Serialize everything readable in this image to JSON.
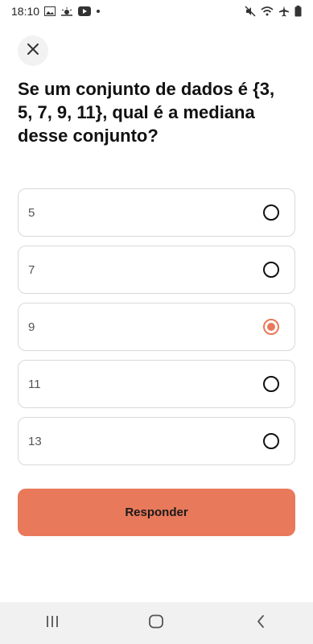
{
  "status_bar": {
    "time": "18:10",
    "left_icons": [
      "image-icon",
      "weather-icon",
      "youtube-icon",
      "dot-icon"
    ],
    "right_icons": [
      "mute-icon",
      "wifi-icon",
      "airplane-icon",
      "battery-icon"
    ]
  },
  "question": {
    "text": "Se um conjunto de dados é {3, 5, 7, 9, 11}, qual é a mediana desse conjunto?"
  },
  "options": [
    {
      "label": "5",
      "selected": false
    },
    {
      "label": "7",
      "selected": false
    },
    {
      "label": "9",
      "selected": true
    },
    {
      "label": "11",
      "selected": false
    },
    {
      "label": "13",
      "selected": false
    }
  ],
  "submit": {
    "label": "Responder"
  },
  "colors": {
    "accent": "#e8795a",
    "border": "#d9d9d9"
  },
  "nav": {
    "icons": [
      "recent-apps-icon",
      "home-icon",
      "back-icon"
    ]
  }
}
